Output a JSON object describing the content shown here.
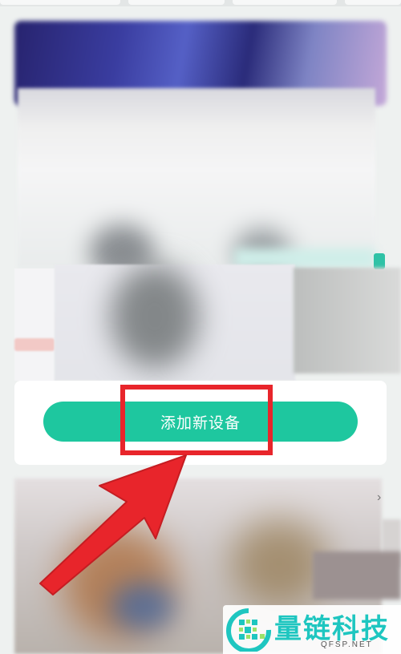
{
  "action_card": {
    "add_device_label": "添加新设备"
  },
  "icons": {
    "chevron": "›"
  },
  "watermark": {
    "name": "量链科技",
    "domain": "QFSP.NET"
  },
  "colors": {
    "accent_green": "#1ec79f",
    "highlight_red": "#e8252b",
    "watermark_teal": "#1ec6c0"
  }
}
